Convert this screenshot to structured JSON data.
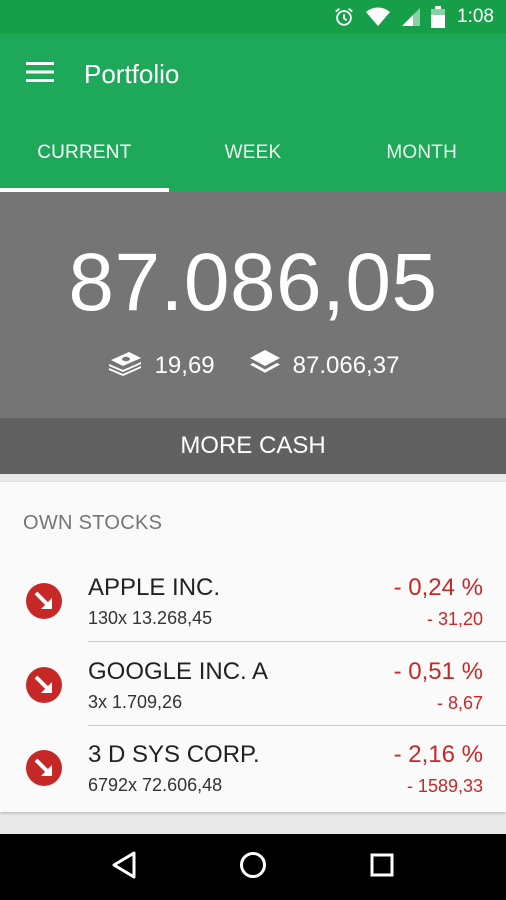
{
  "status_bar": {
    "time": "1:08"
  },
  "app_bar": {
    "title": "Portfolio"
  },
  "tabs": [
    {
      "label": "CURRENT",
      "active": true
    },
    {
      "label": "WEEK",
      "active": false
    },
    {
      "label": "MONTH",
      "active": false
    }
  ],
  "summary": {
    "total": "87.086,05",
    "cash": "19,69",
    "stocks_value": "87.066,37"
  },
  "more_cash_label": "MORE CASH",
  "own_stocks": {
    "header": "OWN STOCKS",
    "items": [
      {
        "name": "APPLE INC.",
        "detail": "130x 13.268,45",
        "pct": "- 0,24 %",
        "abs": "- 31,20"
      },
      {
        "name": "GOOGLE INC. A",
        "detail": "3x 1.709,26",
        "pct": "- 0,51 %",
        "abs": "- 8,67"
      },
      {
        "name": "3 D SYS CORP.",
        "detail": "6792x 72.606,48",
        "pct": "- 2,16 %",
        "abs": "- 1589,33"
      }
    ]
  },
  "colors": {
    "primary": "#1ea95a",
    "status_bar": "#169f48",
    "negative": "#c62828"
  },
  "icons": {
    "status": [
      "alarm-icon",
      "wifi-icon",
      "signal-icon",
      "battery-icon"
    ],
    "cash": "money-stack-icon",
    "stocks": "layers-icon",
    "trend": "arrow-down-right-icon",
    "nav": [
      "back-icon",
      "home-icon",
      "recents-icon"
    ]
  }
}
